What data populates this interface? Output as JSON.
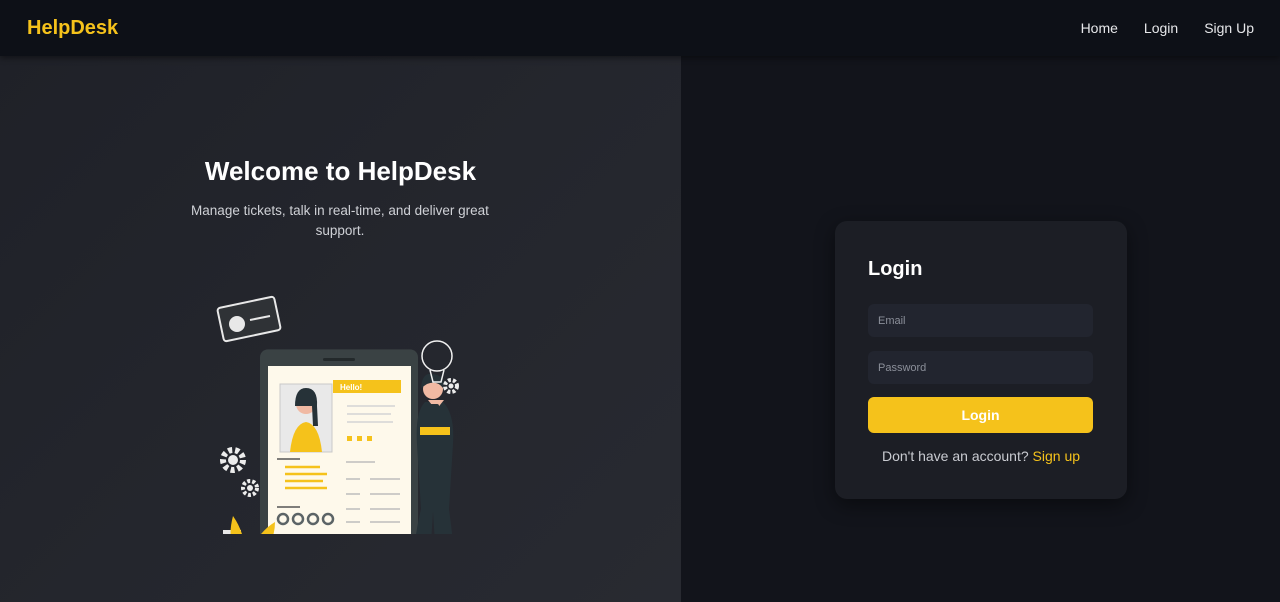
{
  "navbar": {
    "brand": "HelpDesk",
    "links": [
      {
        "label": "Home"
      },
      {
        "label": "Login"
      },
      {
        "label": "Sign Up"
      }
    ]
  },
  "hero": {
    "title": "Welcome to HelpDesk",
    "subtitle": "Manage tickets, talk in real-time, and deliver great support.",
    "illustration_text": "Hello!"
  },
  "login": {
    "title": "Login",
    "email_placeholder": "Email",
    "password_placeholder": "Password",
    "button_label": "Login",
    "signup_prompt": "Don't have an account?",
    "signup_link": "Sign up"
  },
  "colors": {
    "accent": "#f5c21b",
    "background": "#12141b",
    "card": "#1c1e25"
  }
}
